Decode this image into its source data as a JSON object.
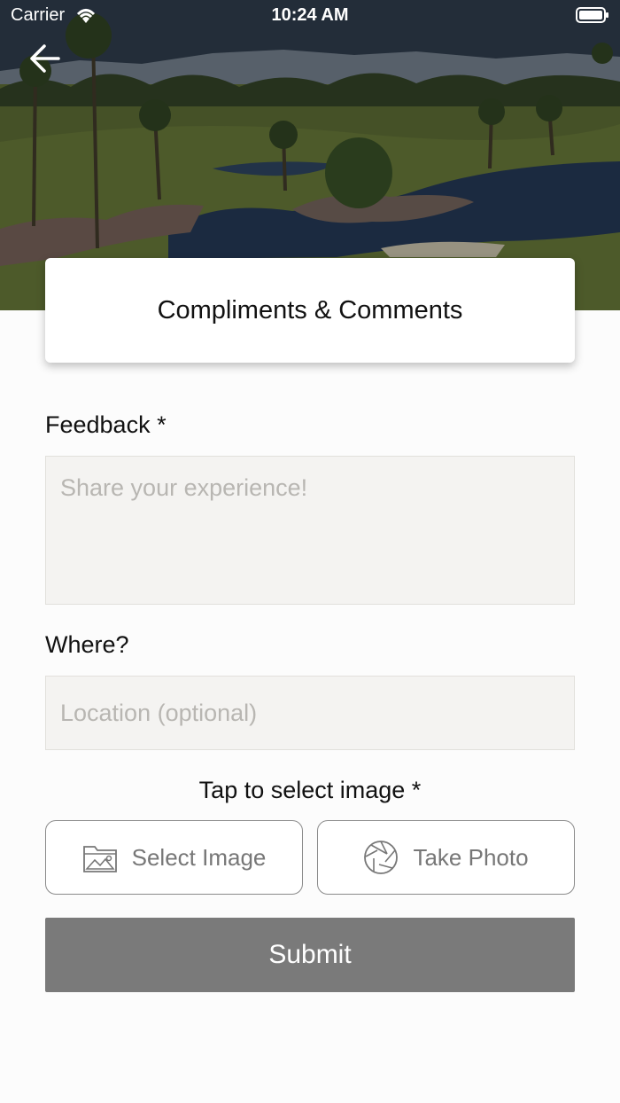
{
  "status_bar": {
    "carrier": "Carrier",
    "time": "10:24 AM"
  },
  "header": {
    "title": "Compliments & Comments",
    "back_icon": "arrow-left-icon",
    "hero_image": "golf-course-lake-photo"
  },
  "form": {
    "feedback_label": "Feedback *",
    "feedback_placeholder": "Share your experience!",
    "feedback_value": "",
    "where_label": "Where?",
    "location_placeholder": "Location (optional)",
    "location_value": "",
    "image_caption": "Tap to select image *",
    "select_image_label": "Select Image",
    "select_image_icon": "image-folder-icon",
    "take_photo_label": "Take Photo",
    "take_photo_icon": "camera-aperture-icon",
    "submit_label": "Submit"
  },
  "colors": {
    "submit_bg": "#7a7a7a",
    "field_bg": "#f4f3f1",
    "page_bg": "#fcfcfc"
  }
}
